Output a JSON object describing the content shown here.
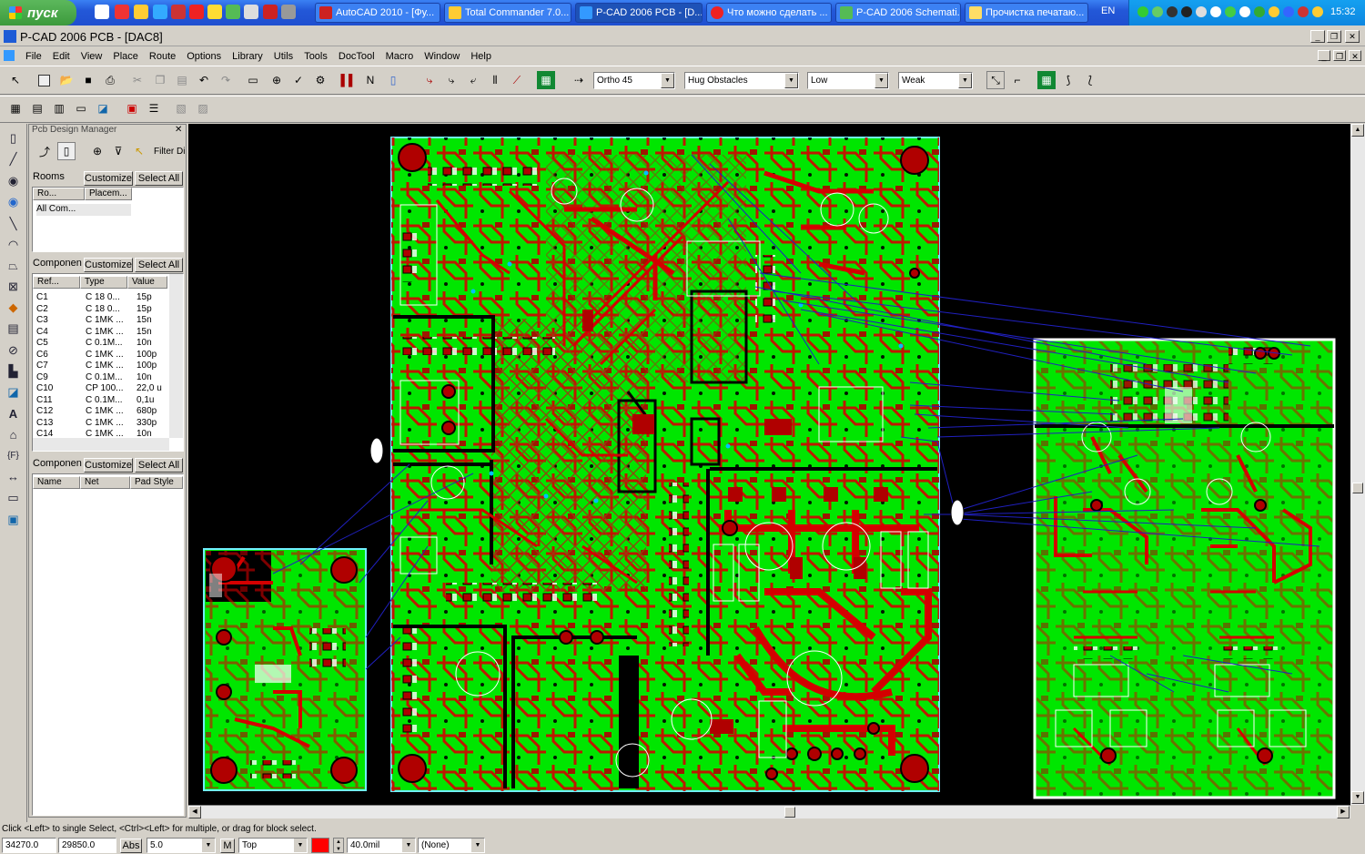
{
  "taskbar": {
    "start_label": "пуск",
    "tasks": [
      {
        "label": "AutoCAD 2010 - [Фу...",
        "icon": "autocad-icon"
      },
      {
        "label": "Total Commander 7.0...",
        "icon": "total-commander-icon"
      },
      {
        "label": "P-CAD 2006 PCB - [D...",
        "icon": "pcad-icon"
      },
      {
        "label": "Что можно сделать ...",
        "icon": "opera-icon"
      },
      {
        "label": "P-CAD 2006 Schemati...",
        "icon": "pcad-schematic-icon"
      },
      {
        "label": "Прочистка печатаю...",
        "icon": "folder-icon"
      }
    ],
    "language": "EN",
    "clock": "15:32"
  },
  "window": {
    "title": "P-CAD 2006 PCB - [DAC8]"
  },
  "menu": [
    "File",
    "Edit",
    "View",
    "Place",
    "Route",
    "Options",
    "Library",
    "Utils",
    "Tools",
    "DocTool",
    "Macro",
    "Window",
    "Help"
  ],
  "toolbar": {
    "route_mode": "Ortho 45",
    "obstacle_mode": "Hug Obstacles",
    "optimization": "Low",
    "strength": "Weak"
  },
  "design_manager": {
    "title": "Pcb Design Manager",
    "filter_label": "Filter Dir",
    "rooms": {
      "label": "Rooms",
      "customize": "Customize",
      "select_all": "Select All",
      "columns": [
        "Ro...",
        "Placem..."
      ],
      "rows": [
        [
          "All Com...",
          ""
        ]
      ]
    },
    "components": {
      "label": "Componen",
      "customize": "Customize",
      "select_all": "Select All",
      "columns": [
        "Ref...",
        "Type",
        "Value"
      ],
      "rows": [
        [
          "C1",
          "C 18 0...",
          "15p"
        ],
        [
          "C2",
          "C 18 0...",
          "15p"
        ],
        [
          "C3",
          "C 1MK ...",
          "15n"
        ],
        [
          "C4",
          "C 1MK ...",
          "15n"
        ],
        [
          "C5",
          "C 0.1M...",
          "10n"
        ],
        [
          "C6",
          "C 1MK ...",
          "100p"
        ],
        [
          "C7",
          "C 1MK ...",
          "100p"
        ],
        [
          "C9",
          "C 0.1M...",
          "10n"
        ],
        [
          "C10",
          "CP 100...",
          "22,0 u"
        ],
        [
          "C11",
          "C 0.1M...",
          "0,1u"
        ],
        [
          "C12",
          "C 1MK ...",
          "680p"
        ],
        [
          "C13",
          "C 1MK ...",
          "330p"
        ],
        [
          "C14",
          "C 1MK ...",
          "10n"
        ]
      ]
    },
    "pads": {
      "label": "Componen",
      "customize": "Customize",
      "select_all": "Select All",
      "columns": [
        "Name",
        "Net",
        "Pad Style"
      ]
    }
  },
  "status": {
    "message": "Click <Left> to single Select, <Ctrl><Left> for multiple, or drag for block select.",
    "x": "34270.0",
    "y": "29850.0",
    "abs": "Abs",
    "grid": "5.0",
    "m": "M",
    "layer": "Top",
    "width": "40.0mil",
    "net": "(None)"
  },
  "colors": {
    "board": "#00e600",
    "trace": "#d40000",
    "inner_trace": "#9a3a10",
    "ratsnest": "#2020c0",
    "outline": "#6ff0ff",
    "copper": "#b00000"
  }
}
